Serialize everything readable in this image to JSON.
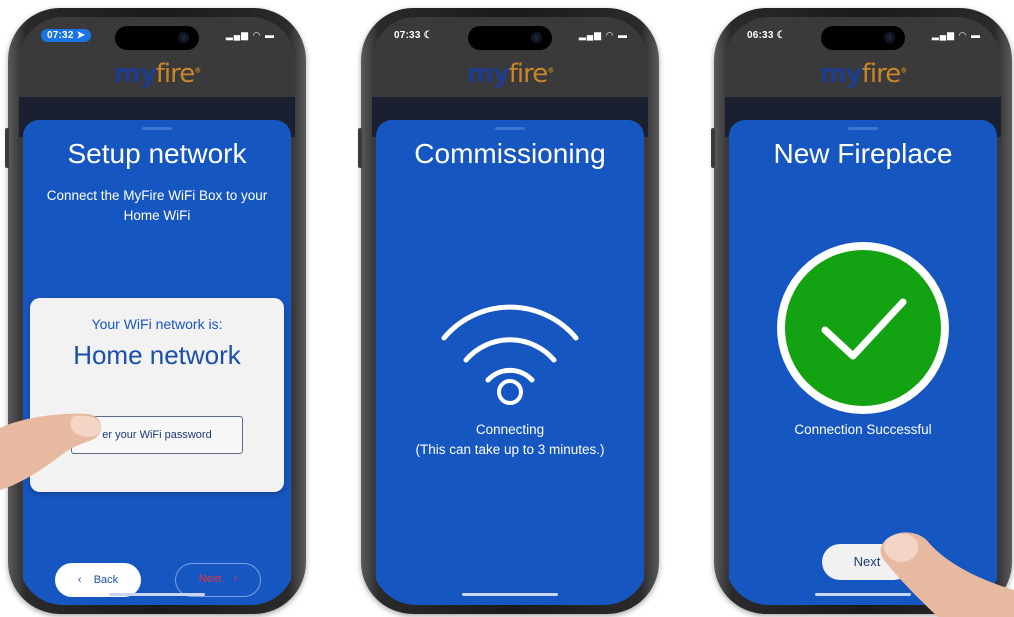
{
  "brand": {
    "my": "my",
    "fire": "fire",
    "reg": "®"
  },
  "phones": [
    {
      "time": "07:32",
      "title": "Setup network",
      "subtitle": "Connect the MyFire WiFi Box to your Home WiFi",
      "card": {
        "label": "Your WiFi network is:",
        "network": "Home network",
        "password_button": "er your WiFi password"
      },
      "back_label": "Back",
      "next_label": "Next"
    },
    {
      "time": "07:33",
      "title": "Commissioning",
      "caption_line1": "Connecting",
      "caption_line2": "(This can take up to 3 minutes.)"
    },
    {
      "time": "06:33",
      "title": "New Fireplace",
      "caption": "Connection Successful",
      "next_label": "Next"
    }
  ],
  "colors": {
    "sheet": "#1656c0",
    "success": "#13a312",
    "next_outline_text": "#e8343a"
  },
  "icons": [
    "location-arrow-icon",
    "moon-icon",
    "signal-icon",
    "wifi-status-icon",
    "battery-icon",
    "wifi-icon",
    "checkmark-icon",
    "chevron-left-icon",
    "chevron-right-icon"
  ]
}
